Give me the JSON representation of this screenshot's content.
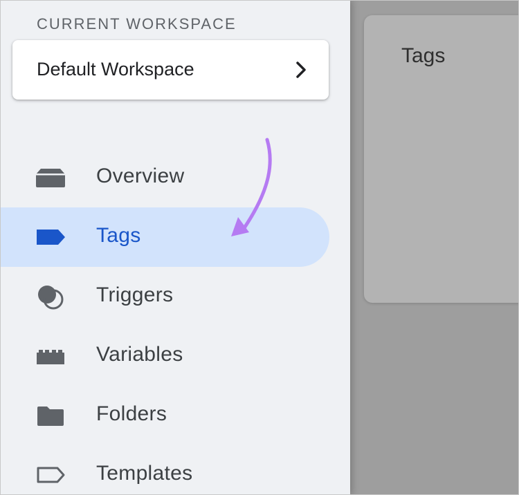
{
  "sidebar": {
    "workspace_label": "CURRENT WORKSPACE",
    "workspace_name": "Default Workspace",
    "nav": [
      {
        "label": "Overview",
        "icon": "overview-icon",
        "active": false
      },
      {
        "label": "Tags",
        "icon": "tag-icon",
        "active": true
      },
      {
        "label": "Triggers",
        "icon": "triggers-icon",
        "active": false
      },
      {
        "label": "Variables",
        "icon": "variables-icon",
        "active": false
      },
      {
        "label": "Folders",
        "icon": "folder-icon",
        "active": false
      },
      {
        "label": "Templates",
        "icon": "templates-icon",
        "active": false
      }
    ]
  },
  "main": {
    "title": "Tags"
  },
  "colors": {
    "active_bg": "#d2e3fc",
    "active_text": "#1a56c9",
    "icon_gray": "#5f6368",
    "annotation_arrow": "#b57bf2",
    "overlay": "#9e9e9e"
  }
}
